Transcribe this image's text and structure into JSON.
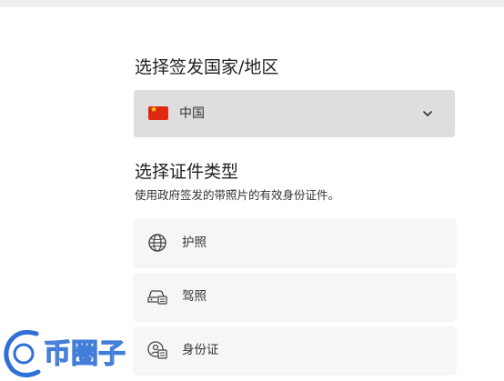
{
  "country_section": {
    "title": "选择签发国家/地区",
    "selected_country": "中国",
    "flag_icon": "china-flag-icon",
    "dropdown_icon": "chevron-down-icon"
  },
  "document_section": {
    "title": "选择证件类型",
    "subtitle": "使用政府签发的带照片的有效身份证件。",
    "options": [
      {
        "label": "护照",
        "icon": "globe-icon"
      },
      {
        "label": "驾照",
        "icon": "car-card-icon"
      },
      {
        "label": "身份证",
        "icon": "id-card-icon"
      }
    ]
  },
  "watermark": {
    "text": "币圈子"
  },
  "colors": {
    "select_background": "#dedede",
    "option_background": "#f6f6f6",
    "flag_red": "#de2910",
    "flag_yellow": "#ffde00",
    "watermark_blue": "#2f6fd6"
  }
}
